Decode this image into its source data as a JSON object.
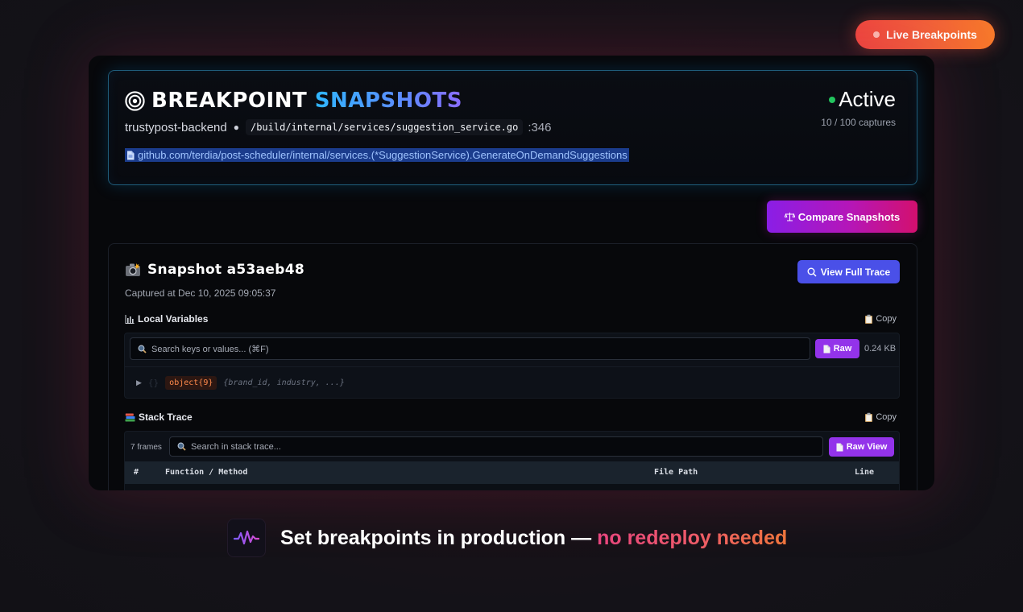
{
  "badge": {
    "label": "Live Breakpoints"
  },
  "header": {
    "title_main": "BREAKPOINT",
    "title_accent": "SNAPSHOTS",
    "service": "trustypost-backend",
    "file_path": "/build/internal/services/suggestion_service.go",
    "line": ":346",
    "function_link": "github.com/terdia/post-scheduler/internal/services.(*SuggestionService).GenerateOnDemandSuggestions",
    "status": "Active",
    "captures": "10 / 100 captures"
  },
  "toolbar": {
    "compare_label": "Compare Snapshots"
  },
  "snapshot": {
    "title": "Snapshot a53aeb48",
    "captured_at": "Captured at Dec 10, 2025 09:05:37",
    "view_trace_label": "View Full Trace",
    "locals": {
      "label": "Local Variables",
      "copy_label": "Copy",
      "search_placeholder": "Search keys or values... (⌘F)",
      "raw_label": "Raw",
      "size": "0.24 KB",
      "object_type": "object{9}",
      "object_preview": "{brand_id, industry, ...}"
    },
    "stack": {
      "label": "Stack Trace",
      "copy_label": "Copy",
      "frames": "7 frames",
      "search_placeholder": "Search in stack trace...",
      "raw_label": "Raw View",
      "columns": [
        "#",
        "Function / Method",
        "File Path",
        "Line"
      ]
    }
  },
  "tagline": {
    "main": "Set breakpoints in production —",
    "accent": "no redeploy needed"
  },
  "colors": {
    "accent_blue": "#4a50e8",
    "accent_purple": "#9333ea",
    "status_green": "#22c55e",
    "live_orange": "#f2603a"
  }
}
